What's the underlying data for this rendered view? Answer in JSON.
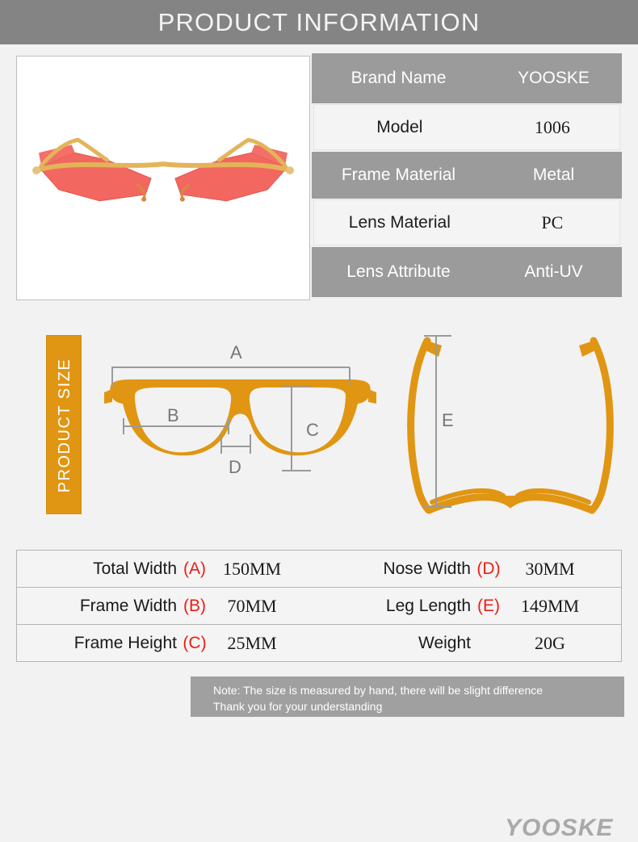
{
  "header": {
    "title": "PRODUCT INFORMATION"
  },
  "colors": {
    "header_bg": "#848484",
    "page_bg": "#f2f2f2",
    "spec_row_gray": "#9b9b9b",
    "spec_row_white": "#f4f4f4",
    "orange": "#e09613",
    "red_key": "#ee1c15",
    "note_bg": "#a0a0a0"
  },
  "product_photo": {
    "alt": "red cat-eye rimless sunglasses with gold metal frame",
    "lens_color": "#f2675f",
    "frame_color": "#e3b459",
    "background": "#ffffff"
  },
  "spec_table": {
    "rows": [
      {
        "label": "Brand Name",
        "value": "YOOSKE",
        "style": "gray"
      },
      {
        "label": "Model",
        "value": "1006",
        "style": "white"
      },
      {
        "label": "Frame Material",
        "value": "Metal",
        "style": "gray"
      },
      {
        "label": "Lens Material",
        "value": "PC",
        "style": "white"
      },
      {
        "label": "Lens Attribute",
        "value": "Anti-UV",
        "style": "gray"
      }
    ]
  },
  "size_section": {
    "banner_label": "PRODUCT SIZE",
    "front_diagram": {
      "dimension_labels": [
        "A",
        "B",
        "C",
        "D"
      ],
      "alt": "front view of eyeglasses frame with dimension markers"
    },
    "top_diagram": {
      "dimension_labels": [
        "E"
      ],
      "alt": "top view of eyeglasses showing temple arms"
    },
    "watermark": "YOOSKE"
  },
  "measurements": {
    "rows": [
      {
        "left": {
          "name": "Total Width",
          "key": "(A)",
          "value": "150MM"
        },
        "right": {
          "name": "Nose Width",
          "key": "(D)",
          "value": "30MM"
        }
      },
      {
        "left": {
          "name": "Frame Width",
          "key": "(B)",
          "value": "70MM"
        },
        "right": {
          "name": "Leg Length",
          "key": "(E)",
          "value": "149MM"
        }
      },
      {
        "left": {
          "name": "Frame Height",
          "key": "(C)",
          "value": "25MM"
        },
        "right": {
          "name": "Weight",
          "key": "",
          "value": "20G"
        }
      }
    ]
  },
  "note": {
    "line1": "Note: The size is measured by hand, there will be slight difference",
    "line2": "Thank you for your understanding"
  }
}
